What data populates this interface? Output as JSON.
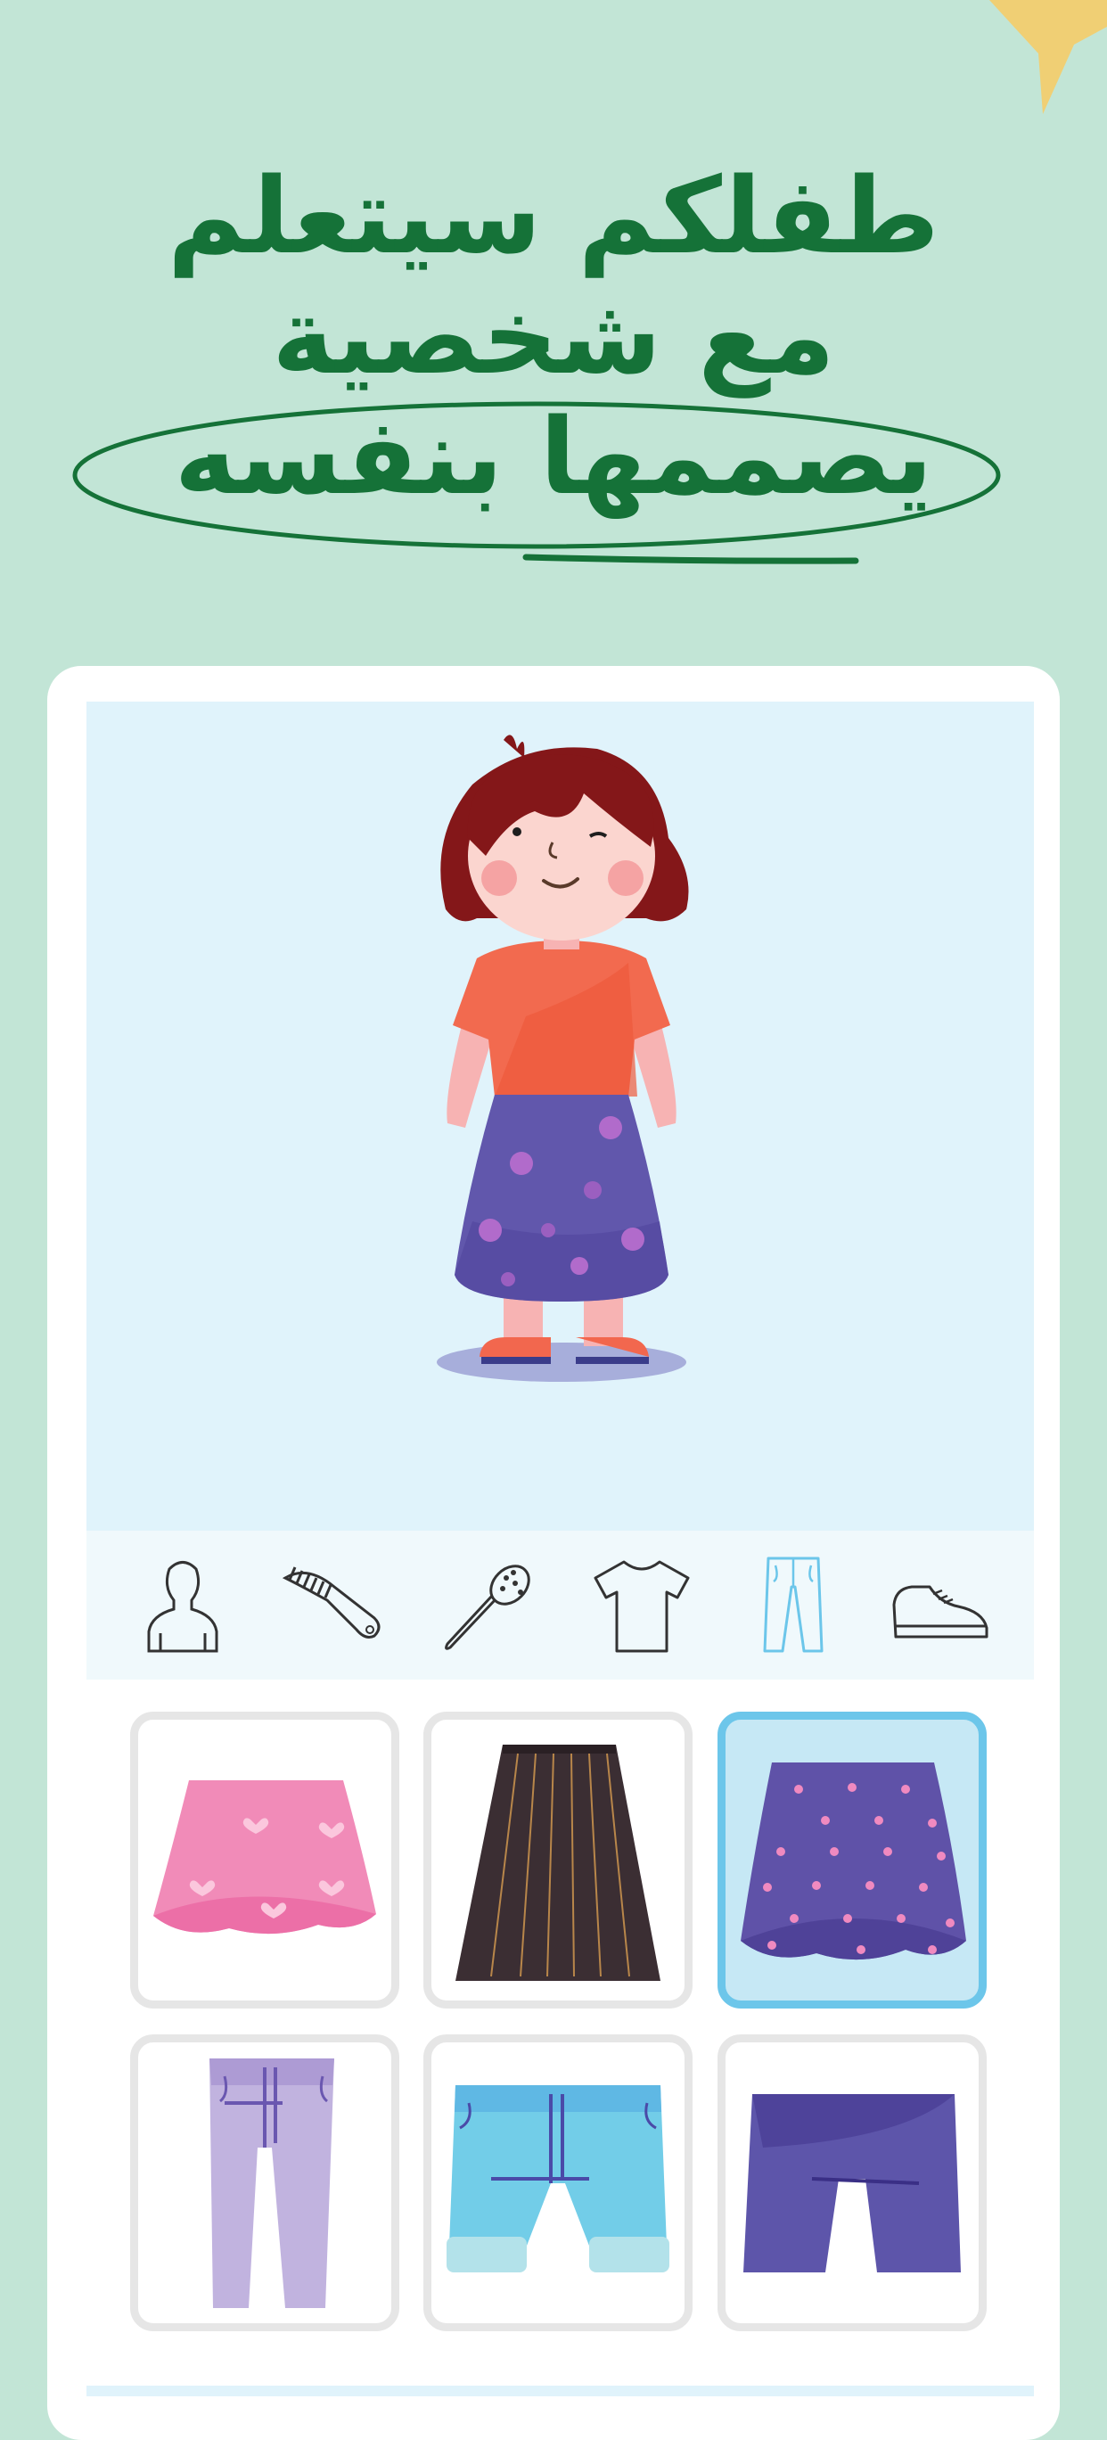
{
  "headline": {
    "line1": "طفلكم سيتعلم",
    "line2": "مع شخصية",
    "line3": "يصممها بنفسه"
  },
  "colors": {
    "background": "#c2e5d6",
    "headline": "#157238",
    "card": "#ffffff",
    "stage": "#e0f3fb",
    "selected_border": "#6cc6ea",
    "star": "#f0cf74"
  },
  "categories": [
    {
      "icon": "body-icon",
      "selected": false
    },
    {
      "icon": "comb-icon",
      "selected": false
    },
    {
      "icon": "hairbrush-icon",
      "selected": false
    },
    {
      "icon": "tshirt-icon",
      "selected": false
    },
    {
      "icon": "pants-icon",
      "selected": true
    },
    {
      "icon": "shoe-icon",
      "selected": false
    }
  ],
  "items": [
    {
      "icon": "pink-heart-skirt-icon",
      "selected": false
    },
    {
      "icon": "black-pleated-skirt-icon",
      "selected": false
    },
    {
      "icon": "purple-polka-dot-skirt-icon",
      "selected": true
    },
    {
      "icon": "lavender-pants-icon",
      "selected": false
    },
    {
      "icon": "blue-cuffed-shorts-icon",
      "selected": false
    },
    {
      "icon": "purple-shorts-icon",
      "selected": false
    }
  ]
}
